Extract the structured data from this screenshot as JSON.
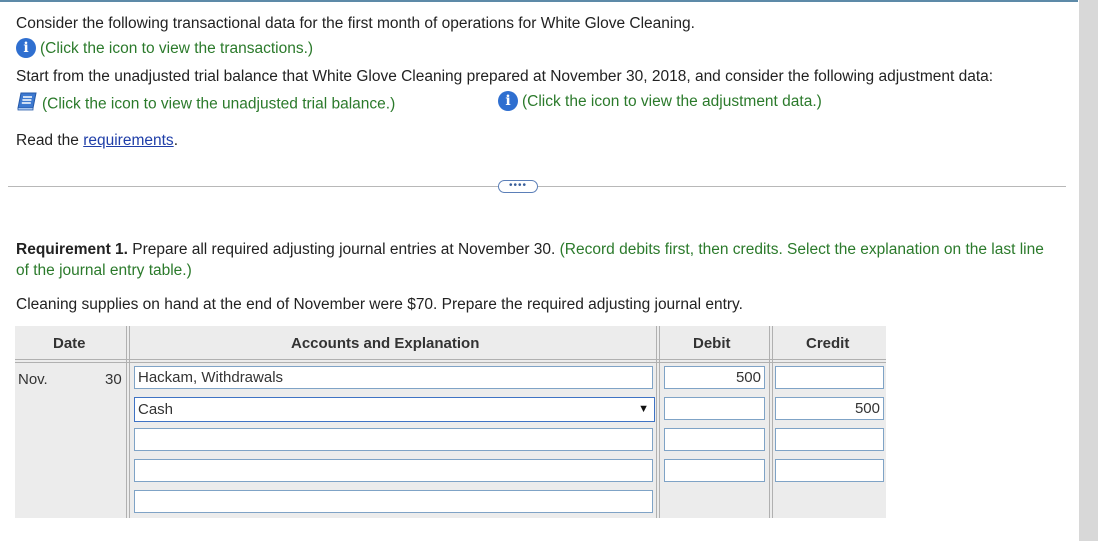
{
  "intro": {
    "line1": "Consider the following transactional data for the first month of operations for White Glove Cleaning.",
    "transactions_link": "(Click the icon to view the transactions.)",
    "line2": "Start from the unadjusted trial balance that White Glove Cleaning prepared at November 30, 2018, and consider the following adjustment data:",
    "trial_balance_link": "(Click the icon to view the unadjusted trial balance.)",
    "adjustment_link": "(Click the icon to view the adjustment data.)",
    "read_prefix": "Read the ",
    "requirements_link": "requirements",
    "read_suffix": "."
  },
  "more_button": "••••",
  "requirement": {
    "label": "Requirement 1.",
    "text": " Prepare all required adjusting journal entries at November 30. ",
    "instruction": "(Record debits first, then credits. Select the explanation on the last line of the journal entry table.)",
    "prompt": "Cleaning supplies on hand at the end of November were $70. Prepare the required adjusting journal entry."
  },
  "table": {
    "headers": {
      "date": "Date",
      "accounts": "Accounts and Explanation",
      "debit": "Debit",
      "credit": "Credit"
    },
    "month": "Nov.",
    "day": "30",
    "rows": [
      {
        "account": "Hackam, Withdrawals",
        "debit": "500",
        "credit": ""
      },
      {
        "account": "Cash",
        "debit": "",
        "credit": "500"
      },
      {
        "account": "",
        "debit": "",
        "credit": ""
      },
      {
        "account": "",
        "debit": "",
        "credit": ""
      },
      {
        "account": ""
      }
    ]
  },
  "colors": {
    "instruction_green": "#2b7a2b",
    "link_blue": "#1f3ea8",
    "icon_blue": "#2f6fd0"
  }
}
